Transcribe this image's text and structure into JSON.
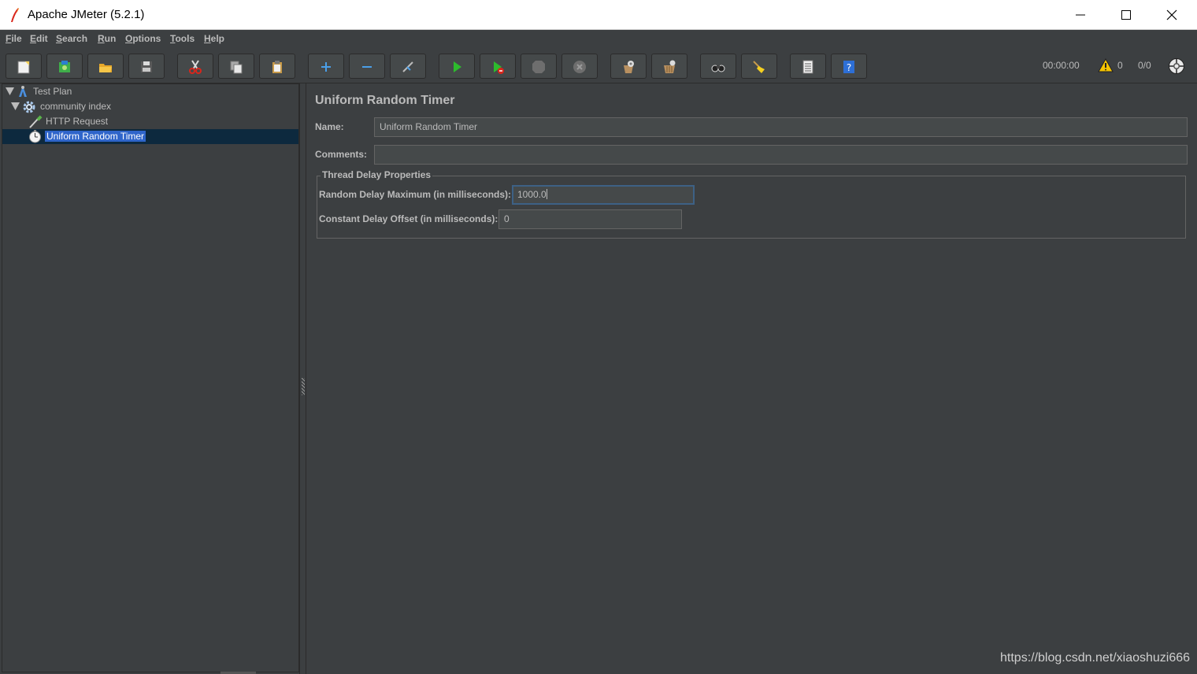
{
  "window": {
    "title": "Apache JMeter (5.2.1)",
    "minimize_icon": "minimize-icon",
    "maximize_icon": "maximize-icon",
    "close_icon": "close-icon"
  },
  "menu": [
    "File",
    "Edit",
    "Search",
    "Run",
    "Options",
    "Tools",
    "Help"
  ],
  "toolbar": {
    "buttons": [
      {
        "name": "new-icon"
      },
      {
        "name": "templates-icon"
      },
      {
        "name": "open-icon"
      },
      {
        "name": "save-icon"
      },
      {
        "name": "cut-icon"
      },
      {
        "name": "copy-icon"
      },
      {
        "name": "paste-icon"
      },
      {
        "name": "expand-all-icon"
      },
      {
        "name": "collapse-all-icon"
      },
      {
        "name": "toggle-icon"
      },
      {
        "name": "start-icon"
      },
      {
        "name": "start-no-pauses-icon"
      },
      {
        "name": "stop-icon"
      },
      {
        "name": "shutdown-icon"
      },
      {
        "name": "clear-icon"
      },
      {
        "name": "clear-all-icon"
      },
      {
        "name": "search-icon"
      },
      {
        "name": "reset-search-icon"
      },
      {
        "name": "function-helper-icon"
      },
      {
        "name": "help-icon"
      }
    ],
    "elapsed_time": "00:00:00",
    "warning_count": "0",
    "threads": "0/0"
  },
  "tree": {
    "items": [
      {
        "label": "Test Plan",
        "icon": "test-plan-icon"
      },
      {
        "label": "community index",
        "icon": "thread-group-gear-icon"
      },
      {
        "label": "HTTP Request",
        "icon": "sampler-pipette-icon"
      },
      {
        "label": "Uniform Random Timer",
        "icon": "timer-clock-icon",
        "selected": true
      }
    ]
  },
  "panel": {
    "title": "Uniform Random Timer",
    "name_label": "Name:",
    "name_value": "Uniform Random Timer",
    "comments_label": "Comments:",
    "comments_value": "",
    "group_title": "Thread Delay Properties",
    "random_delay_label": "Random Delay Maximum (in milliseconds):",
    "random_delay_value": "1000.0",
    "constant_delay_label": "Constant Delay Offset (in milliseconds):",
    "constant_delay_value": "0"
  },
  "watermark": "https://blog.csdn.net/xiaoshuzi666",
  "colors": {
    "background": "#3c3f41",
    "selection": "#2f65ca",
    "text": "#bbbbbb"
  }
}
